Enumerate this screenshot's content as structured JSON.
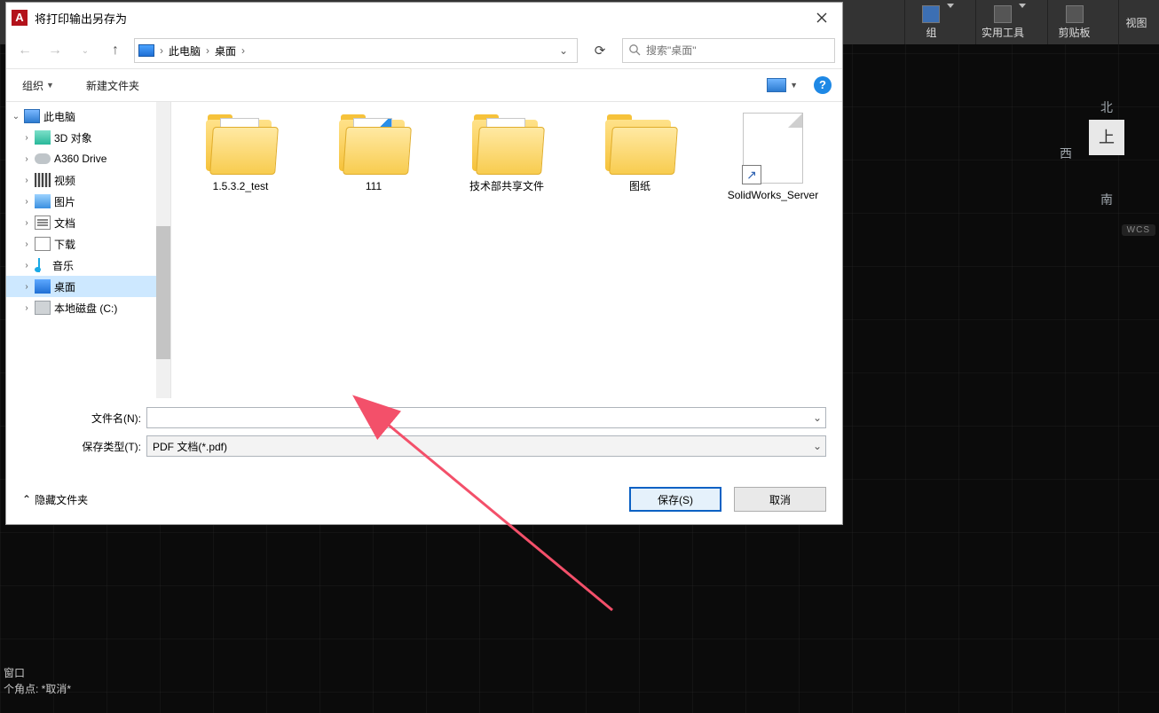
{
  "ribbon": {
    "group_label": "组",
    "tools_label": "实用工具",
    "clipboard_label": "剪贴板",
    "view_label": "视图"
  },
  "viewcube": {
    "n": "北",
    "s": "南",
    "w": "西",
    "face": "上",
    "wcs": "WCS"
  },
  "cmdline": {
    "l1": "窗口",
    "l2": "个角点:  *取消*"
  },
  "dialog": {
    "title": "将打印输出另存为",
    "breadcrumb": {
      "root": "此电脑",
      "leaf": "桌面"
    },
    "search_placeholder": "搜索\"桌面\"",
    "toolbar": {
      "organize": "组织",
      "newfolder": "新建文件夹"
    },
    "tree": {
      "root": "此电脑",
      "items": [
        "3D 对象",
        "A360 Drive",
        "视频",
        "图片",
        "文档",
        "下载",
        "音乐",
        "桌面",
        "本地磁盘 (C:)"
      ]
    },
    "files": [
      {
        "name": "1.5.3.2_test",
        "type": "folder-paper"
      },
      {
        "name": "111",
        "type": "folder-blue"
      },
      {
        "name": "技术部共享文件",
        "type": "folder-paper"
      },
      {
        "name": "图纸",
        "type": "folder"
      },
      {
        "name": "SolidWorks_Server",
        "type": "shortcut"
      }
    ],
    "form": {
      "filename_label": "文件名(N):",
      "filetype_label": "保存类型(T):",
      "filetype_value": "PDF 文档(*.pdf)",
      "hide_folders": "隐藏文件夹",
      "save": "保存(S)",
      "cancel": "取消"
    }
  }
}
